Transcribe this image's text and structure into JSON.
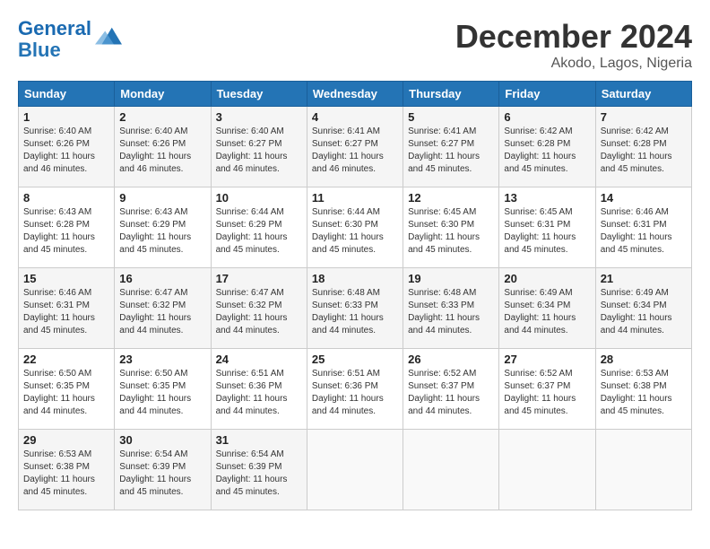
{
  "header": {
    "logo_line1": "General",
    "logo_line2": "Blue",
    "month": "December 2024",
    "location": "Akodo, Lagos, Nigeria"
  },
  "weekdays": [
    "Sunday",
    "Monday",
    "Tuesday",
    "Wednesday",
    "Thursday",
    "Friday",
    "Saturday"
  ],
  "weeks": [
    [
      {
        "day": "1",
        "sunrise": "6:40 AM",
        "sunset": "6:26 PM",
        "daylight": "11 hours and 46 minutes."
      },
      {
        "day": "2",
        "sunrise": "6:40 AM",
        "sunset": "6:26 PM",
        "daylight": "11 hours and 46 minutes."
      },
      {
        "day": "3",
        "sunrise": "6:40 AM",
        "sunset": "6:27 PM",
        "daylight": "11 hours and 46 minutes."
      },
      {
        "day": "4",
        "sunrise": "6:41 AM",
        "sunset": "6:27 PM",
        "daylight": "11 hours and 46 minutes."
      },
      {
        "day": "5",
        "sunrise": "6:41 AM",
        "sunset": "6:27 PM",
        "daylight": "11 hours and 45 minutes."
      },
      {
        "day": "6",
        "sunrise": "6:42 AM",
        "sunset": "6:28 PM",
        "daylight": "11 hours and 45 minutes."
      },
      {
        "day": "7",
        "sunrise": "6:42 AM",
        "sunset": "6:28 PM",
        "daylight": "11 hours and 45 minutes."
      }
    ],
    [
      {
        "day": "8",
        "sunrise": "6:43 AM",
        "sunset": "6:28 PM",
        "daylight": "11 hours and 45 minutes."
      },
      {
        "day": "9",
        "sunrise": "6:43 AM",
        "sunset": "6:29 PM",
        "daylight": "11 hours and 45 minutes."
      },
      {
        "day": "10",
        "sunrise": "6:44 AM",
        "sunset": "6:29 PM",
        "daylight": "11 hours and 45 minutes."
      },
      {
        "day": "11",
        "sunrise": "6:44 AM",
        "sunset": "6:30 PM",
        "daylight": "11 hours and 45 minutes."
      },
      {
        "day": "12",
        "sunrise": "6:45 AM",
        "sunset": "6:30 PM",
        "daylight": "11 hours and 45 minutes."
      },
      {
        "day": "13",
        "sunrise": "6:45 AM",
        "sunset": "6:31 PM",
        "daylight": "11 hours and 45 minutes."
      },
      {
        "day": "14",
        "sunrise": "6:46 AM",
        "sunset": "6:31 PM",
        "daylight": "11 hours and 45 minutes."
      }
    ],
    [
      {
        "day": "15",
        "sunrise": "6:46 AM",
        "sunset": "6:31 PM",
        "daylight": "11 hours and 45 minutes."
      },
      {
        "day": "16",
        "sunrise": "6:47 AM",
        "sunset": "6:32 PM",
        "daylight": "11 hours and 44 minutes."
      },
      {
        "day": "17",
        "sunrise": "6:47 AM",
        "sunset": "6:32 PM",
        "daylight": "11 hours and 44 minutes."
      },
      {
        "day": "18",
        "sunrise": "6:48 AM",
        "sunset": "6:33 PM",
        "daylight": "11 hours and 44 minutes."
      },
      {
        "day": "19",
        "sunrise": "6:48 AM",
        "sunset": "6:33 PM",
        "daylight": "11 hours and 44 minutes."
      },
      {
        "day": "20",
        "sunrise": "6:49 AM",
        "sunset": "6:34 PM",
        "daylight": "11 hours and 44 minutes."
      },
      {
        "day": "21",
        "sunrise": "6:49 AM",
        "sunset": "6:34 PM",
        "daylight": "11 hours and 44 minutes."
      }
    ],
    [
      {
        "day": "22",
        "sunrise": "6:50 AM",
        "sunset": "6:35 PM",
        "daylight": "11 hours and 44 minutes."
      },
      {
        "day": "23",
        "sunrise": "6:50 AM",
        "sunset": "6:35 PM",
        "daylight": "11 hours and 44 minutes."
      },
      {
        "day": "24",
        "sunrise": "6:51 AM",
        "sunset": "6:36 PM",
        "daylight": "11 hours and 44 minutes."
      },
      {
        "day": "25",
        "sunrise": "6:51 AM",
        "sunset": "6:36 PM",
        "daylight": "11 hours and 44 minutes."
      },
      {
        "day": "26",
        "sunrise": "6:52 AM",
        "sunset": "6:37 PM",
        "daylight": "11 hours and 44 minutes."
      },
      {
        "day": "27",
        "sunrise": "6:52 AM",
        "sunset": "6:37 PM",
        "daylight": "11 hours and 45 minutes."
      },
      {
        "day": "28",
        "sunrise": "6:53 AM",
        "sunset": "6:38 PM",
        "daylight": "11 hours and 45 minutes."
      }
    ],
    [
      {
        "day": "29",
        "sunrise": "6:53 AM",
        "sunset": "6:38 PM",
        "daylight": "11 hours and 45 minutes."
      },
      {
        "day": "30",
        "sunrise": "6:54 AM",
        "sunset": "6:39 PM",
        "daylight": "11 hours and 45 minutes."
      },
      {
        "day": "31",
        "sunrise": "6:54 AM",
        "sunset": "6:39 PM",
        "daylight": "11 hours and 45 minutes."
      },
      null,
      null,
      null,
      null
    ]
  ]
}
